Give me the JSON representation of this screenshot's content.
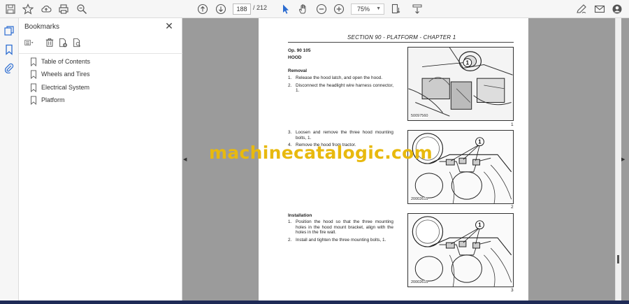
{
  "toolbar": {
    "page_current": "188",
    "page_total": "/ 212",
    "zoom": "75%"
  },
  "bookmarks_panel": {
    "title": "Bookmarks",
    "items": [
      {
        "label": "Table of Contents"
      },
      {
        "label": "Wheels and Tires"
      },
      {
        "label": "Electrical System"
      },
      {
        "label": "Platform"
      }
    ]
  },
  "document": {
    "section_header": "SECTION 90 - PLATFORM - CHAPTER 1",
    "op_number": "Op. 90 105",
    "op_title": "HOOD",
    "removal_heading": "Removal",
    "removal_steps": [
      {
        "num": "1.",
        "text": "Release the hood latch, and open the hood."
      },
      {
        "num": "2.",
        "text": "Disconnect the headlight wire harness connector, 1."
      }
    ],
    "removal_steps_2": [
      {
        "num": "3.",
        "text": "Loosen and remove the three hood mounting bolts, 1."
      },
      {
        "num": "4.",
        "text": "Remove the hood from tractor."
      }
    ],
    "installation_heading": "Installation",
    "installation_steps": [
      {
        "num": "1.",
        "text": "Position the hood so that the three mounting holes in the hood mount bracket, align with the holes in the fire wall."
      },
      {
        "num": "2.",
        "text": "Install and tighten the three mounting bolts, 1."
      }
    ],
    "figures": [
      {
        "code": "50097560",
        "number": "1",
        "callout": "1"
      },
      {
        "code": "20002615",
        "number": "2",
        "callout": "1"
      },
      {
        "code": "20002615",
        "number": "3",
        "callout": "1"
      }
    ]
  },
  "watermark": "machinecatalogic.com",
  "colors": {
    "accent": "#2b6cd1",
    "watermark": "#e8b90e",
    "doc_background": "#9b9b9b"
  }
}
